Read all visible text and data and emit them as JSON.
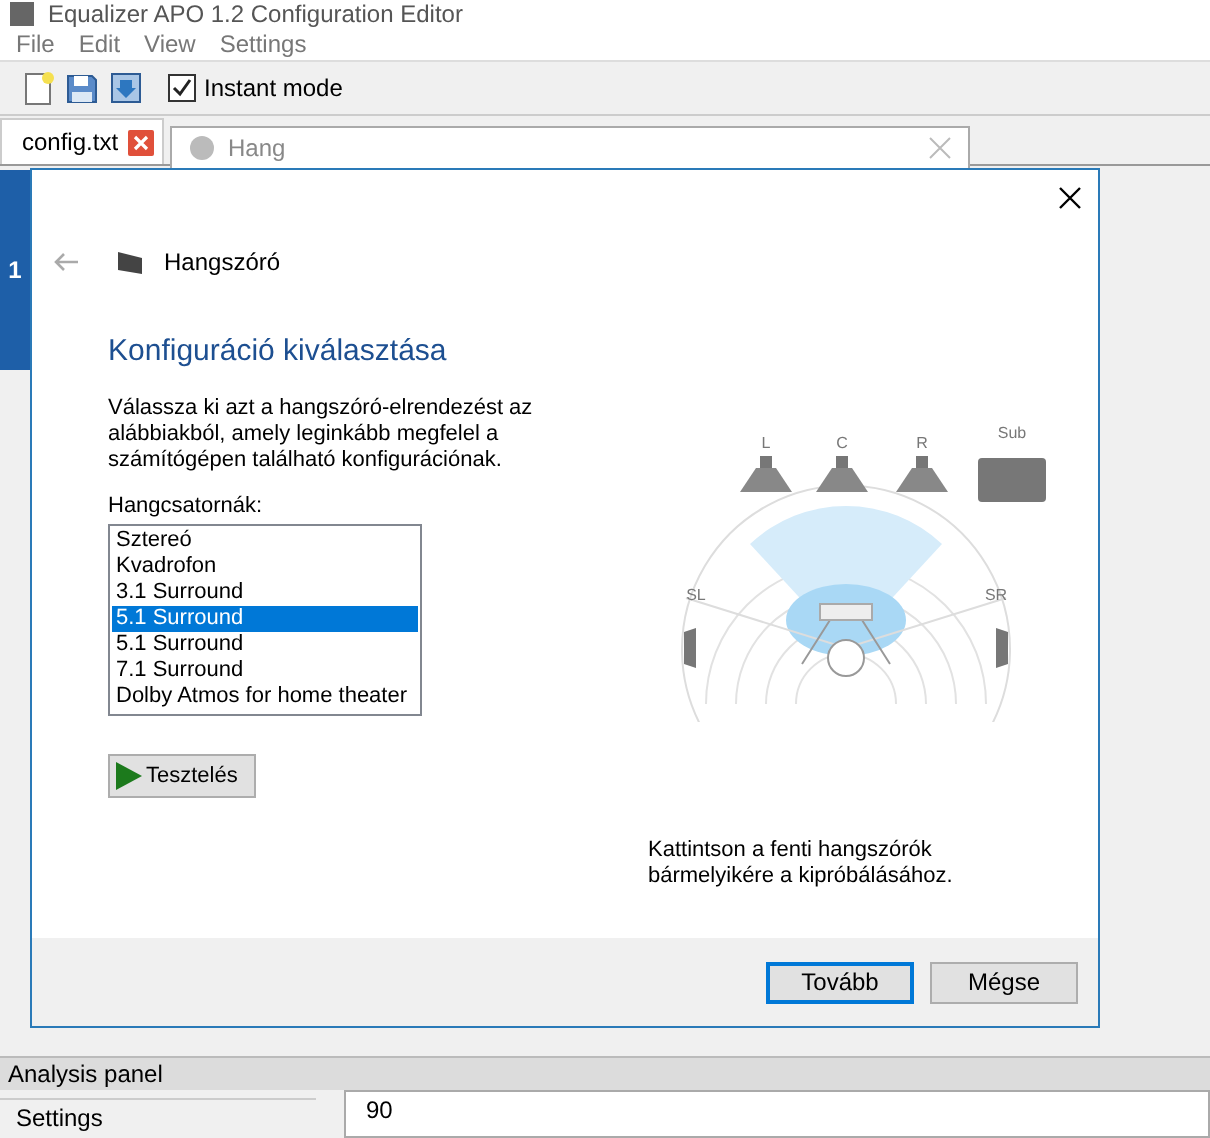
{
  "app": {
    "title": "Equalizer APO 1.2 Configuration Editor",
    "menu": [
      "File",
      "Edit",
      "View",
      "Settings"
    ],
    "instant_mode": {
      "label": "Instant mode",
      "checked": true
    },
    "tabs": [
      {
        "label": "config.txt",
        "selected": true
      }
    ],
    "side_marker": "1"
  },
  "background_window": {
    "title": "Hang"
  },
  "dialog": {
    "breadcrumb": "Hangszóró",
    "heading": "Konfiguráció kiválasztása",
    "description": "Válassza ki azt a hangszóró-elrendezést az alábbiakból, amely leginkább megfelel a számítógépen található konfigurációnak.",
    "channels_label": "Hangcsatornák:",
    "channels": [
      {
        "label": "Sztereó",
        "selected": false
      },
      {
        "label": "Kvadrofon",
        "selected": false
      },
      {
        "label": "3.1 Surround",
        "selected": false
      },
      {
        "label": "5.1 Surround",
        "selected": true
      },
      {
        "label": "5.1 Surround",
        "selected": false
      },
      {
        "label": "7.1 Surround",
        "selected": false
      },
      {
        "label": "Dolby Atmos for home theater",
        "selected": false
      }
    ],
    "test_button": "Tesztelés",
    "speakers": [
      "L",
      "C",
      "R",
      "Sub",
      "SL",
      "SR"
    ],
    "hint": "Kattintson a fenti hangszórók bármelyikére a kipróbálásához.",
    "buttons": [
      {
        "label": "Tovább",
        "default": true
      },
      {
        "label": "Mégse",
        "default": false
      }
    ]
  },
  "analysis_panel": {
    "title": "Analysis panel",
    "settings_label": "Settings",
    "value": "90"
  }
}
